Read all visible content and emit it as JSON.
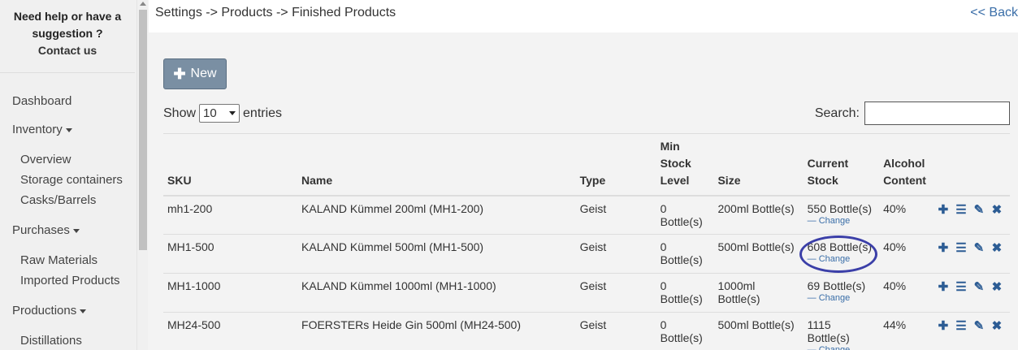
{
  "sidebar": {
    "help_line1": "Need help or have a",
    "help_line2": "suggestion ?",
    "contact": "Contact us",
    "dashboard": "Dashboard",
    "inventory": "Inventory",
    "inventory_items": [
      "Overview",
      "Storage containers",
      "Casks/Barrels"
    ],
    "purchases": "Purchases",
    "purchases_items": [
      "Raw Materials",
      "Imported Products"
    ],
    "productions": "Productions",
    "productions_items": [
      "Distillations"
    ]
  },
  "header": {
    "breadcrumb": "Settings -> Products -> Finished Products",
    "back": "<< Back"
  },
  "toolbar": {
    "new_label": "New",
    "show_label": "Show",
    "entries_value": "10",
    "entries_label": "entries",
    "search_label": "Search:"
  },
  "table": {
    "headers": {
      "sku": "SKU",
      "name": "Name",
      "type": "Type",
      "min_stock_1": "Min",
      "min_stock_2": "Stock",
      "min_stock_3": "Level",
      "size": "Size",
      "current_stock_1": "Current",
      "current_stock_2": "Stock",
      "alcohol_1": "Alcohol",
      "alcohol_2": "Content"
    },
    "change_label": "Change",
    "rows": [
      {
        "sku": "mh1-200",
        "name": "KALAND Kümmel 200ml (MH1-200)",
        "type": "Geist",
        "min_stock": "0 Bottle(s)",
        "size": "200ml Bottle(s)",
        "current_stock": "550 Bottle(s)",
        "alcohol": "40%"
      },
      {
        "sku": "MH1-500",
        "name": "KALAND Kümmel 500ml (MH1-500)",
        "type": "Geist",
        "min_stock": "0 Bottle(s)",
        "size": "500ml Bottle(s)",
        "current_stock": "608 Bottle(s)",
        "alcohol": "40%"
      },
      {
        "sku": "MH1-1000",
        "name": "KALAND Kümmel 1000ml (MH1-1000)",
        "type": "Geist",
        "min_stock": "0 Bottle(s)",
        "size": "1000ml Bottle(s)",
        "current_stock": "69 Bottle(s)",
        "alcohol": "40%"
      },
      {
        "sku": "MH24-500",
        "name": "FOERSTERs Heide Gin 500ml (MH24-500)",
        "type": "Geist",
        "min_stock": "0 Bottle(s)",
        "size": "500ml Bottle(s)",
        "current_stock": "1115 Bottle(s)",
        "alcohol": "44%"
      }
    ]
  },
  "icons": {
    "plus": "plus-icon",
    "list": "list-icon",
    "edit": "edit-icon",
    "delete": "close-icon"
  }
}
